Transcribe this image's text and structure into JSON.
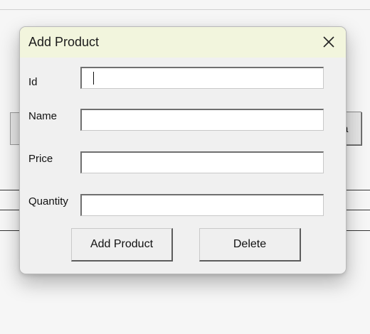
{
  "background": {
    "right_button_fragment": "a"
  },
  "dialog": {
    "title": "Add Product",
    "fields": [
      {
        "label": "Id",
        "value": ""
      },
      {
        "label": "Name",
        "value": ""
      },
      {
        "label": "Price",
        "value": ""
      },
      {
        "label": "Quantity",
        "value": ""
      }
    ],
    "buttons": {
      "add_label": "Add Product",
      "delete_label": "Delete"
    },
    "close_icon": "close-icon"
  },
  "colors": {
    "titlebar": "#f2f5dd",
    "dialog_body": "#f0f0f0",
    "field_background": "#ffffff"
  }
}
